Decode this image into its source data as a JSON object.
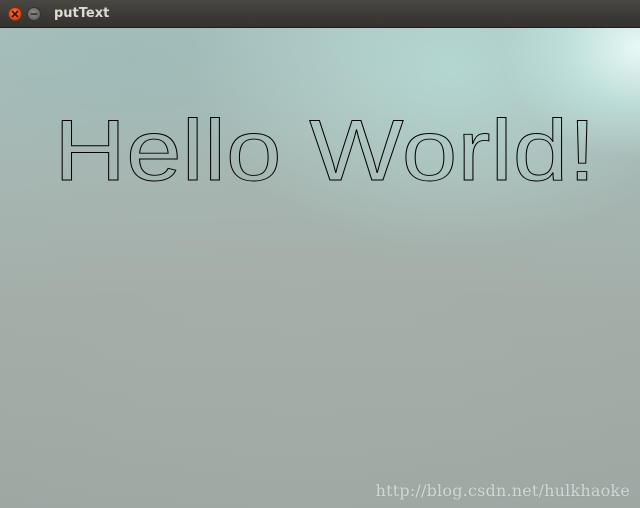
{
  "window": {
    "title": "putText"
  },
  "canvas": {
    "text": "Hello World!",
    "text_color": "#000000"
  },
  "watermark": "http://blog.csdn.net/hulkhaoke"
}
